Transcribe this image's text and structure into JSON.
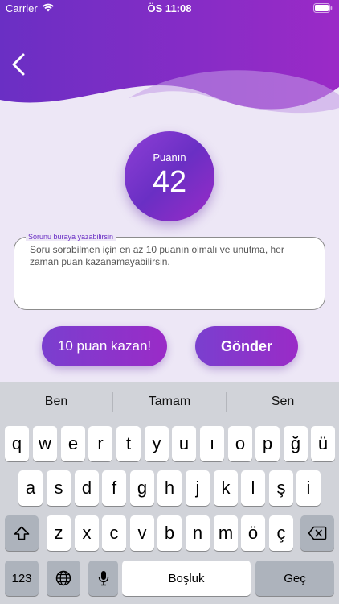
{
  "status_bar": {
    "carrier": "Carrier",
    "time": "ÖS 11:08"
  },
  "points": {
    "label": "Puanın",
    "value": "42"
  },
  "question": {
    "label": "Sorunu buraya yazabilirsin",
    "text": "Soru sorabilmen için en az 10 puanın olmalı ve unutma, her zaman puan kazanamayabilirsin."
  },
  "buttons": {
    "earn": "10 puan kazan!",
    "send": "Gönder"
  },
  "keyboard": {
    "suggestions": [
      "Ben",
      "Tamam",
      "Sen"
    ],
    "row1": [
      "q",
      "w",
      "e",
      "r",
      "t",
      "y",
      "u",
      "ı",
      "o",
      "p",
      "ğ",
      "ü"
    ],
    "row2": [
      "a",
      "s",
      "d",
      "f",
      "g",
      "h",
      "j",
      "k",
      "l",
      "ş",
      "i"
    ],
    "row3": [
      "z",
      "x",
      "c",
      "v",
      "b",
      "n",
      "m",
      "ö",
      "ç"
    ],
    "numbers_key": "123",
    "space_key": "Boşluk",
    "return_key": "Geç"
  },
  "colors": {
    "accent": "#6a2fc4",
    "accent_pink": "#9a2bc7",
    "background": "#ede7f6"
  }
}
